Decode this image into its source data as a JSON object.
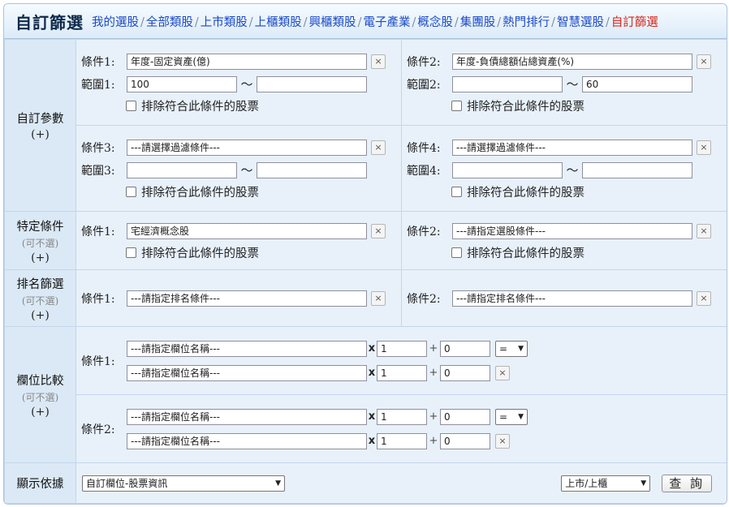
{
  "header": {
    "title": "自訂篩選",
    "nav": [
      {
        "label": "我的選股",
        "active": false
      },
      {
        "label": "全部類股",
        "active": false
      },
      {
        "label": "上市類股",
        "active": false
      },
      {
        "label": "上櫃類股",
        "active": false
      },
      {
        "label": "興櫃類股",
        "active": false
      },
      {
        "label": "電子產業",
        "active": false
      },
      {
        "label": "概念股",
        "active": false
      },
      {
        "label": "集團股",
        "active": false
      },
      {
        "label": "熱門排行",
        "active": false
      },
      {
        "label": "智慧選股",
        "active": false
      },
      {
        "label": "自訂篩選",
        "active": true
      }
    ],
    "separator": "/"
  },
  "common": {
    "exclude_label": "排除符合此條件的股票",
    "close_glyph": "×",
    "tilde": "～",
    "plus_hint": "(+)",
    "optional_hint": "(可不選)",
    "mult": "x",
    "add": "+"
  },
  "custom_params": {
    "section_label": "自訂參數",
    "conditions": [
      {
        "label": "條件1:",
        "value": "年度-固定資產(億)",
        "range_label": "範圍1:",
        "min": "100",
        "max": ""
      },
      {
        "label": "條件2:",
        "value": "年度-負債總額佔總資產(%)",
        "range_label": "範圍2:",
        "min": "",
        "max": "60"
      },
      {
        "label": "條件3:",
        "value": "---請選擇過濾條件---",
        "range_label": "範圍3:",
        "min": "",
        "max": ""
      },
      {
        "label": "條件4:",
        "value": "---請選擇過濾條件---",
        "range_label": "範圍4:",
        "min": "",
        "max": ""
      }
    ]
  },
  "specific": {
    "section_label": "特定條件",
    "conditions": [
      {
        "label": "條件1:",
        "value": "宅經濟概念股"
      },
      {
        "label": "條件2:",
        "value": "---請指定選股條件---"
      }
    ]
  },
  "ranking": {
    "section_label": "排名篩選",
    "conditions": [
      {
        "label": "條件1:",
        "value": "---請指定排名條件---"
      },
      {
        "label": "條件2:",
        "value": "---請指定排名條件---"
      }
    ]
  },
  "compare": {
    "section_label": "欄位比較",
    "conditions": [
      {
        "label": "條件1:",
        "field_a": "---請指定欄位名稱---",
        "mult_a": "1",
        "add_a": "0",
        "op": "=",
        "field_b": "---請指定欄位名稱---",
        "mult_b": "1",
        "add_b": "0"
      },
      {
        "label": "條件2:",
        "field_a": "---請指定欄位名稱---",
        "mult_a": "1",
        "add_a": "0",
        "op": "=",
        "field_b": "---請指定欄位名稱---",
        "mult_b": "1",
        "add_b": "0"
      }
    ]
  },
  "display": {
    "section_label": "顯示依據",
    "columns_value": "自訂欄位-股票資訊",
    "market_value": "上市/上櫃",
    "query_label": "查 詢"
  }
}
